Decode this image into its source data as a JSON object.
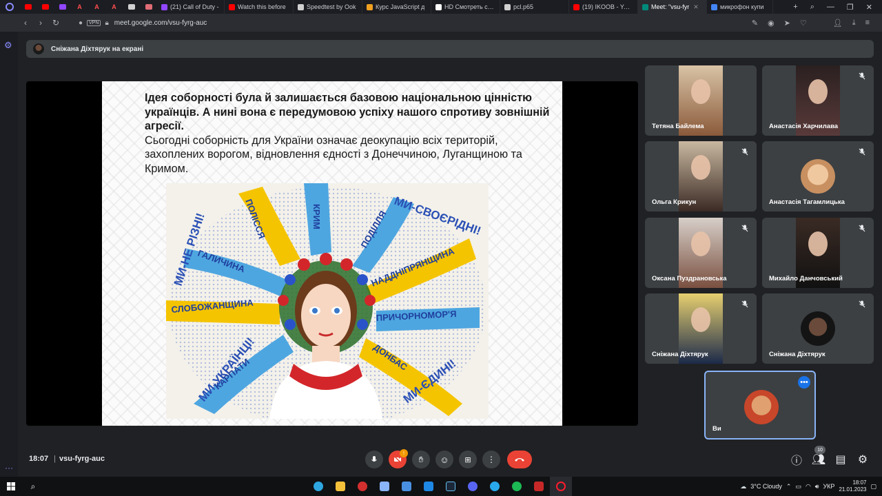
{
  "browser": {
    "pinned": [
      {
        "icon": "youtube-icon",
        "color": "#ff0000",
        "label": ""
      },
      {
        "icon": "youtube-icon",
        "color": "#ff0000",
        "label": ""
      },
      {
        "icon": "twitch-icon",
        "color": "#9146ff",
        "label": ""
      },
      {
        "icon": "a-icon",
        "color": "#ff4d4d",
        "label": "A"
      },
      {
        "icon": "a-icon",
        "color": "#ff4d4d",
        "label": "A"
      },
      {
        "icon": "a-icon",
        "color": "#ff4d4d",
        "label": "A"
      },
      {
        "icon": "github-icon",
        "color": "#d0d0d0",
        "label": ""
      },
      {
        "icon": "site-icon",
        "color": "#e06c75",
        "label": ""
      }
    ],
    "tabs": [
      {
        "title": "(21) Call of Duty -",
        "color": "#9146ff",
        "active": false
      },
      {
        "title": "Watch this before",
        "color": "#ff0000",
        "active": false
      },
      {
        "title": "Speedtest by Ook",
        "color": "#d0d0d0",
        "active": false
      },
      {
        "title": "Курс JavaScript д",
        "color": "#f0a020",
        "active": false
      },
      {
        "title": "HD Смотреть сериал",
        "color": "#ffffff",
        "active": false
      },
      {
        "title": "pcl.p65",
        "color": "#d0d0d0",
        "active": false
      },
      {
        "title": "(19) IKOOB - YouT",
        "color": "#ff0000",
        "active": false
      },
      {
        "title": "Meet: \"vsu-fyr",
        "color": "#00897b",
        "active": true
      },
      {
        "title": "микрофон купи",
        "color": "#4285f4",
        "active": false
      }
    ],
    "vpn_label": "VPN",
    "url": "meet.google.com/vsu-fyrg-auc"
  },
  "meet": {
    "presenter_banner": "Сніжана Діхтярук на екрані",
    "slide": {
      "bold_text": "Ідея соборності була й залишається базовою національною цінністю українців. А нині вона є передумовою успіху нашого спротиву зовнішній агресії.",
      "normal_text": "Сьогодні соборність для України означає деокупацію всіх територій, захоплених ворогом, відновлення єдності з Донеччиною, Луганщиною та Кримом."
    },
    "poster": {
      "corner_texts": [
        "МИ-НЕ РІЗНІ!",
        "МИ-СВОЄРІДНІ!",
        "МИ-УКРАЇНЦІ!",
        "МИ-ЄДИНІ!"
      ],
      "regions": [
        "ПОЛІССЯ",
        "КРИМ",
        "ПОДІЛЛЯ",
        "ГАЛИЧИНА",
        "НАДДНІПРЯНЩИНА",
        "СЛОБОЖАНЩИНА",
        "ПРИЧОРНОМОР'Я",
        "КАРПАТИ",
        "ДОНБАС"
      ]
    },
    "participants": [
      {
        "name": "Тетяна Байлема",
        "muted": false,
        "kind": "video"
      },
      {
        "name": "Анастасія Харчилава",
        "muted": true,
        "kind": "video"
      },
      {
        "name": "Ольга Крикун",
        "muted": true,
        "kind": "video"
      },
      {
        "name": "Анастасія Тагамлицька",
        "muted": true,
        "kind": "avatar"
      },
      {
        "name": "Оксана Пуздрановська",
        "muted": true,
        "kind": "video"
      },
      {
        "name": "Михайло Данчовський",
        "muted": true,
        "kind": "video"
      },
      {
        "name": "Сніжана Діхтярук",
        "muted": true,
        "kind": "video"
      },
      {
        "name": "Сніжана Діхтярук",
        "muted": true,
        "kind": "avatar"
      }
    ],
    "self_tile": {
      "name": "Ви"
    },
    "bottom": {
      "time": "18:07",
      "separator": "|",
      "meeting_code": "vsu-fyrg-auc",
      "camera_badge": "!",
      "participants_count": "10"
    }
  },
  "taskbar": {
    "weather": "3°C  Cloudy",
    "language": "УКР",
    "time": "18:07",
    "date": "21.01.2023"
  }
}
